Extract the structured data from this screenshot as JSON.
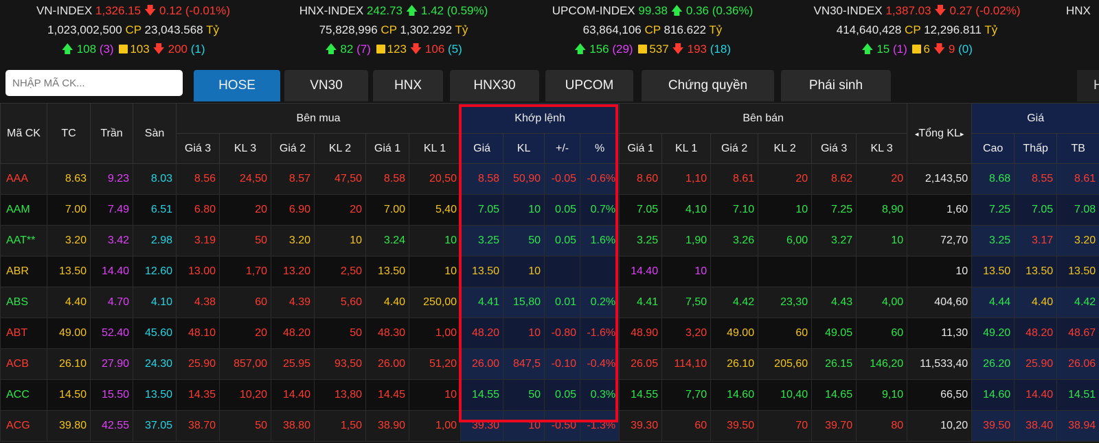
{
  "indices": [
    {
      "name": "VN-INDEX",
      "value": "1,326.15",
      "change": "0.12 (-0.01%)",
      "dir": "down",
      "volume": "1,023,002,500",
      "cp_label": "CP",
      "value_ty": "23,043.568",
      "ty_label": "Tỷ",
      "adv": "108",
      "ceil_count": "(3)",
      "unch": "103",
      "dec": "200",
      "floor_count": "(1)"
    },
    {
      "name": "HNX-INDEX",
      "value": "242.73",
      "change": "1.42 (0.59%)",
      "dir": "up",
      "volume": "75,828,996",
      "cp_label": "CP",
      "value_ty": "1,302.292",
      "ty_label": "Tỷ",
      "adv": "82",
      "ceil_count": "(7)",
      "unch": "123",
      "dec": "106",
      "floor_count": "(5)"
    },
    {
      "name": "UPCOM-INDEX",
      "value": "99.38",
      "change": "0.36 (0.36%)",
      "dir": "up",
      "volume": "63,864,106",
      "cp_label": "CP",
      "value_ty": "816.622",
      "ty_label": "Tỷ",
      "adv": "156",
      "ceil_count": "(29)",
      "unch": "537",
      "dec": "193",
      "floor_count": "(18)"
    },
    {
      "name": "VN30-INDEX",
      "value": "1,387.03",
      "change": "0.27 (-0.02%)",
      "dir": "down",
      "volume": "414,640,428",
      "cp_label": "CP",
      "value_ty": "12,296.811",
      "ty_label": "Tỷ",
      "adv": "15",
      "ceil_count": "(1)",
      "unch": "6",
      "dec": "9",
      "floor_count": "(0)"
    },
    {
      "name": "HNX"
    }
  ],
  "search": {
    "placeholder": "NHẬP MÃ CK..."
  },
  "tabs": [
    {
      "label": "HOSE",
      "active": true
    },
    {
      "label": "VN30"
    },
    {
      "label": "HNX"
    },
    {
      "label": "HNX30"
    },
    {
      "label": "UPCOM"
    },
    {
      "label": "Chứng quyền"
    },
    {
      "label": "Phái sinh"
    }
  ],
  "tab_more_label": "H",
  "headers": {
    "symbol": "Mã CK",
    "ref": "TC",
    "ceil": "Trần",
    "floor": "Sàn",
    "buy_group": "Bên mua",
    "match_group": "Khớp lệnh",
    "sell_group": "Bên bán",
    "total": "Tổng KL",
    "price_group": "Giá",
    "buy": [
      "Giá 3",
      "KL 3",
      "Giá 2",
      "KL 2",
      "Giá 1",
      "KL 1"
    ],
    "match": [
      "Giá",
      "KL",
      "+/-",
      "%"
    ],
    "sell": [
      "Giá 1",
      "KL 1",
      "Giá 2",
      "KL 2",
      "Giá 3",
      "KL 3"
    ],
    "price": [
      "Cao",
      "Thấp",
      "TB"
    ]
  },
  "colors": {
    "up": "#2ee84a",
    "down": "#ff3b30",
    "ref": "#f5c518",
    "ceil": "#e040fb",
    "floor": "#23d7e6",
    "white": "#e8e8e8",
    "highlight_box": "#e8091f",
    "active_tab": "#1670b8"
  },
  "rows": [
    {
      "sym": [
        "AAA",
        "d"
      ],
      "tc": "8.63",
      "tran": "9.23",
      "san": "8.03",
      "buy": [
        [
          "8.56",
          "d"
        ],
        [
          "24,50",
          "d"
        ],
        [
          "8.57",
          "d"
        ],
        [
          "47,50",
          "d"
        ],
        [
          "8.58",
          "d"
        ],
        [
          "20,50",
          "d"
        ]
      ],
      "match": [
        [
          "8.58",
          "d"
        ],
        [
          "50,90",
          "d"
        ],
        [
          "-0.05",
          "d"
        ],
        [
          "-0.6%",
          "d"
        ]
      ],
      "sell": [
        [
          "8.60",
          "d"
        ],
        [
          "1,10",
          "d"
        ],
        [
          "8.61",
          "d"
        ],
        [
          "20",
          "d"
        ],
        [
          "8.62",
          "d"
        ],
        [
          "20",
          "d"
        ]
      ],
      "total": "2,143,50",
      "price": [
        [
          "8.68",
          "u"
        ],
        [
          "8.55",
          "d"
        ],
        [
          "8.61",
          "d"
        ]
      ]
    },
    {
      "sym": [
        "AAM",
        "u"
      ],
      "tc": "7.00",
      "tran": "7.49",
      "san": "6.51",
      "buy": [
        [
          "6.80",
          "d"
        ],
        [
          "20",
          "d"
        ],
        [
          "6.90",
          "d"
        ],
        [
          "20",
          "d"
        ],
        [
          "7.00",
          "r"
        ],
        [
          "5,40",
          "r"
        ]
      ],
      "match": [
        [
          "7.05",
          "u"
        ],
        [
          "10",
          "u"
        ],
        [
          "0.05",
          "u"
        ],
        [
          "0.7%",
          "u"
        ]
      ],
      "sell": [
        [
          "7.05",
          "u"
        ],
        [
          "4,10",
          "u"
        ],
        [
          "7.10",
          "u"
        ],
        [
          "10",
          "u"
        ],
        [
          "7.25",
          "u"
        ],
        [
          "8,90",
          "u"
        ]
      ],
      "total": "1,60",
      "price": [
        [
          "7.25",
          "u"
        ],
        [
          "7.05",
          "u"
        ],
        [
          "7.08",
          "u"
        ]
      ]
    },
    {
      "sym": [
        "AAT**",
        "u"
      ],
      "tc": "3.20",
      "tran": "3.42",
      "san": "2.98",
      "buy": [
        [
          "3.19",
          "d"
        ],
        [
          "50",
          "d"
        ],
        [
          "3.20",
          "r"
        ],
        [
          "10",
          "r"
        ],
        [
          "3.24",
          "u"
        ],
        [
          "10",
          "u"
        ]
      ],
      "match": [
        [
          "3.25",
          "u"
        ],
        [
          "50",
          "u"
        ],
        [
          "0.05",
          "u"
        ],
        [
          "1.6%",
          "u"
        ]
      ],
      "sell": [
        [
          "3.25",
          "u"
        ],
        [
          "1,90",
          "u"
        ],
        [
          "3.26",
          "u"
        ],
        [
          "6,00",
          "u"
        ],
        [
          "3.27",
          "u"
        ],
        [
          "10",
          "u"
        ]
      ],
      "total": "72,70",
      "price": [
        [
          "3.25",
          "u"
        ],
        [
          "3.17",
          "d"
        ],
        [
          "3.20",
          "r"
        ]
      ]
    },
    {
      "sym": [
        "ABR",
        "r"
      ],
      "tc": "13.50",
      "tran": "14.40",
      "san": "12.60",
      "buy": [
        [
          "13.00",
          "d"
        ],
        [
          "1,70",
          "d"
        ],
        [
          "13.20",
          "d"
        ],
        [
          "2,50",
          "d"
        ],
        [
          "13.50",
          "r"
        ],
        [
          "10",
          "r"
        ]
      ],
      "match": [
        [
          "13.50",
          "r"
        ],
        [
          "10",
          "r"
        ],
        [
          "",
          ""
        ],
        [
          "",
          ""
        ]
      ],
      "sell": [
        [
          "14.40",
          "c"
        ],
        [
          "10",
          "c"
        ],
        [
          "",
          ""
        ],
        [
          "",
          ""
        ],
        [
          "",
          ""
        ],
        [
          "",
          ""
        ]
      ],
      "total": "10",
      "price": [
        [
          "13.50",
          "r"
        ],
        [
          "13.50",
          "r"
        ],
        [
          "13.50",
          "r"
        ]
      ]
    },
    {
      "sym": [
        "ABS",
        "u"
      ],
      "tc": "4.40",
      "tran": "4.70",
      "san": "4.10",
      "buy": [
        [
          "4.38",
          "d"
        ],
        [
          "60",
          "d"
        ],
        [
          "4.39",
          "d"
        ],
        [
          "5,60",
          "d"
        ],
        [
          "4.40",
          "r"
        ],
        [
          "250,00",
          "r"
        ]
      ],
      "match": [
        [
          "4.41",
          "u"
        ],
        [
          "15,80",
          "u"
        ],
        [
          "0.01",
          "u"
        ],
        [
          "0.2%",
          "u"
        ]
      ],
      "sell": [
        [
          "4.41",
          "u"
        ],
        [
          "7,50",
          "u"
        ],
        [
          "4.42",
          "u"
        ],
        [
          "23,30",
          "u"
        ],
        [
          "4.43",
          "u"
        ],
        [
          "4,00",
          "u"
        ]
      ],
      "total": "404,60",
      "price": [
        [
          "4.44",
          "u"
        ],
        [
          "4.40",
          "r"
        ],
        [
          "4.42",
          "u"
        ]
      ]
    },
    {
      "sym": [
        "ABT",
        "d"
      ],
      "tc": "49.00",
      "tran": "52.40",
      "san": "45.60",
      "buy": [
        [
          "48.10",
          "d"
        ],
        [
          "20",
          "d"
        ],
        [
          "48.20",
          "d"
        ],
        [
          "50",
          "d"
        ],
        [
          "48.30",
          "d"
        ],
        [
          "1,00",
          "d"
        ]
      ],
      "match": [
        [
          "48.20",
          "d"
        ],
        [
          "10",
          "d"
        ],
        [
          "-0.80",
          "d"
        ],
        [
          "-1.6%",
          "d"
        ]
      ],
      "sell": [
        [
          "48.90",
          "d"
        ],
        [
          "3,20",
          "d"
        ],
        [
          "49.00",
          "r"
        ],
        [
          "60",
          "r"
        ],
        [
          "49.05",
          "u"
        ],
        [
          "60",
          "u"
        ]
      ],
      "total": "11,30",
      "price": [
        [
          "49.20",
          "u"
        ],
        [
          "48.20",
          "d"
        ],
        [
          "48.67",
          "d"
        ]
      ]
    },
    {
      "sym": [
        "ACB",
        "d"
      ],
      "tc": "26.10",
      "tran": "27.90",
      "san": "24.30",
      "buy": [
        [
          "25.90",
          "d"
        ],
        [
          "857,00",
          "d"
        ],
        [
          "25.95",
          "d"
        ],
        [
          "93,50",
          "d"
        ],
        [
          "26.00",
          "d"
        ],
        [
          "51,20",
          "d"
        ]
      ],
      "match": [
        [
          "26.00",
          "d"
        ],
        [
          "847,5",
          "d"
        ],
        [
          "-0.10",
          "d"
        ],
        [
          "-0.4%",
          "d"
        ]
      ],
      "sell": [
        [
          "26.05",
          "d"
        ],
        [
          "114,10",
          "d"
        ],
        [
          "26.10",
          "r"
        ],
        [
          "205,60",
          "r"
        ],
        [
          "26.15",
          "u"
        ],
        [
          "146,20",
          "u"
        ]
      ],
      "total": "11,533,40",
      "price": [
        [
          "26.20",
          "u"
        ],
        [
          "25.90",
          "d"
        ],
        [
          "26.06",
          "d"
        ]
      ]
    },
    {
      "sym": [
        "ACC",
        "u"
      ],
      "tc": "14.50",
      "tran": "15.50",
      "san": "13.50",
      "buy": [
        [
          "14.35",
          "d"
        ],
        [
          "10,20",
          "d"
        ],
        [
          "14.40",
          "d"
        ],
        [
          "13,80",
          "d"
        ],
        [
          "14.45",
          "d"
        ],
        [
          "10",
          "d"
        ]
      ],
      "match": [
        [
          "14.55",
          "u"
        ],
        [
          "50",
          "u"
        ],
        [
          "0.05",
          "u"
        ],
        [
          "0.3%",
          "u"
        ]
      ],
      "sell": [
        [
          "14.55",
          "u"
        ],
        [
          "7,70",
          "u"
        ],
        [
          "14.60",
          "u"
        ],
        [
          "10,40",
          "u"
        ],
        [
          "14.65",
          "u"
        ],
        [
          "9,10",
          "u"
        ]
      ],
      "total": "66,50",
      "price": [
        [
          "14.60",
          "u"
        ],
        [
          "14.40",
          "d"
        ],
        [
          "14.51",
          "u"
        ]
      ]
    },
    {
      "sym": [
        "ACG",
        "d"
      ],
      "tc": "39.80",
      "tran": "42.55",
      "san": "37.05",
      "buy": [
        [
          "38.70",
          "d"
        ],
        [
          "50",
          "d"
        ],
        [
          "38.80",
          "d"
        ],
        [
          "1,50",
          "d"
        ],
        [
          "38.90",
          "d"
        ],
        [
          "1,00",
          "d"
        ]
      ],
      "match": [
        [
          "39.30",
          "d"
        ],
        [
          "10",
          "d"
        ],
        [
          "-0.50",
          "d"
        ],
        [
          "-1.3%",
          "d"
        ]
      ],
      "sell": [
        [
          "39.30",
          "d"
        ],
        [
          "60",
          "d"
        ],
        [
          "39.50",
          "d"
        ],
        [
          "70",
          "d"
        ],
        [
          "39.70",
          "d"
        ],
        [
          "80",
          "d"
        ]
      ],
      "total": "10,20",
      "price": [
        [
          "39.50",
          "d"
        ],
        [
          "38.40",
          "d"
        ],
        [
          "38.94",
          "d"
        ]
      ]
    }
  ]
}
